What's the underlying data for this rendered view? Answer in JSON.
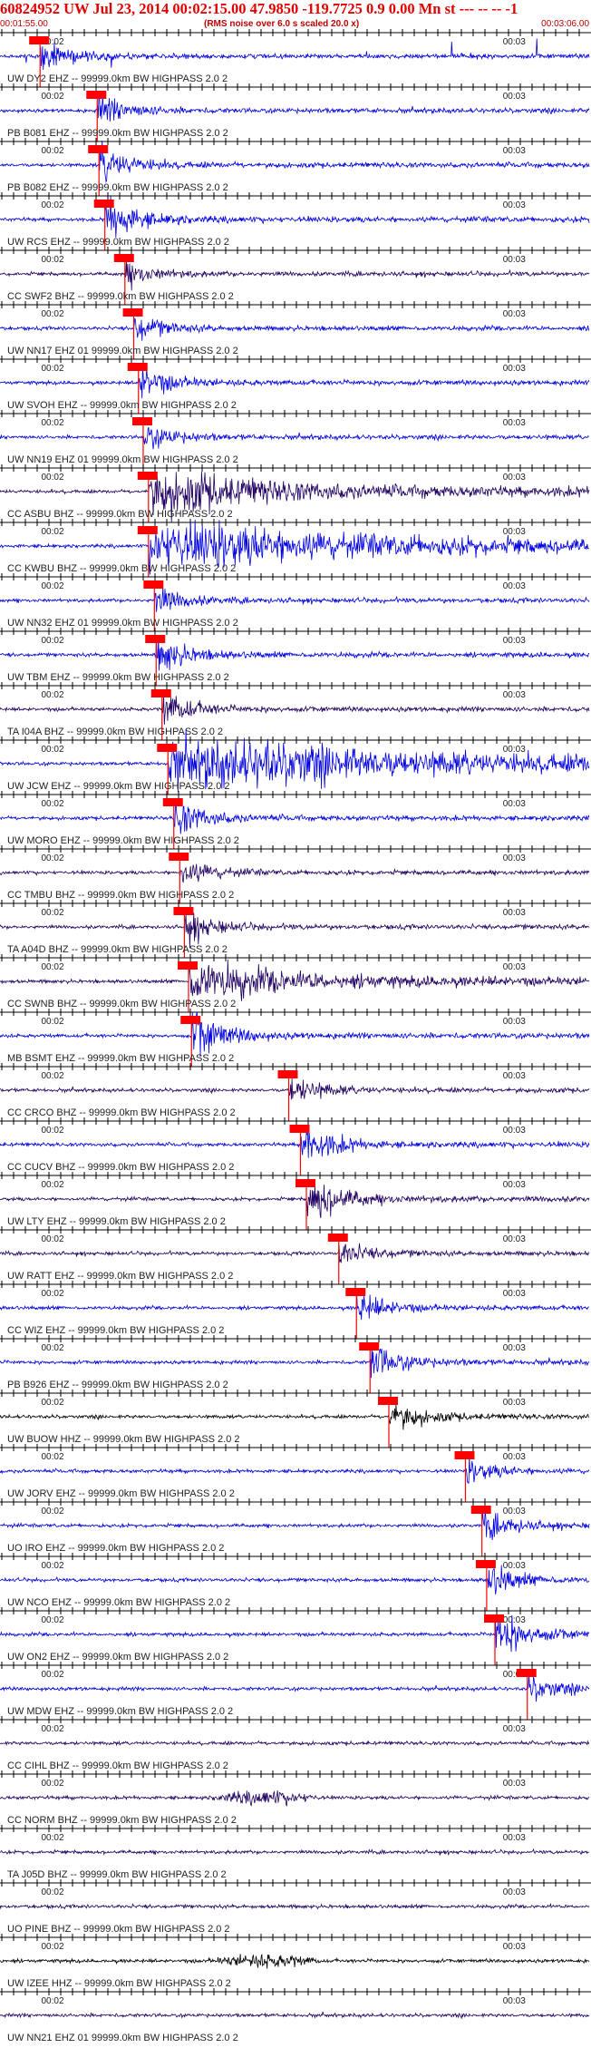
{
  "header": {
    "title": "60824952 UW Jul 23, 2014 00:02:15.00    47.9850 -119.7725  0.9 0.00 Mn st --- -- --  -1",
    "start_time": "00:01:55.00",
    "rms_note": "(RMS noise over 6.0 s scaled 20.0 x)",
    "end_time": "00:03:06.00"
  },
  "chart_data": {
    "type": "seismogram-record-section",
    "time_range": [
      "00:01:55.00",
      "00:03:06.00"
    ],
    "tick_marks": [
      "00:02",
      "00:03"
    ],
    "pick_color": "#ff0000",
    "traces": [
      {
        "label": "UW DY2 EHZ -- 99999.0km BW  HIGHPASS  2.0  2",
        "color": "#0000e0",
        "pick": 0.068,
        "amp": 0.35,
        "style": "spikes"
      },
      {
        "label": "PB B081 EHZ -- 99999.0km BW  HIGHPASS  2.0  2",
        "color": "#0000e0",
        "pick": 0.165,
        "amp": 0.45,
        "style": "event"
      },
      {
        "label": "PB B082 EHZ -- 99999.0km BW  HIGHPASS  2.0  2",
        "color": "#0000e0",
        "pick": 0.168,
        "amp": 0.6,
        "style": "event"
      },
      {
        "label": "UW RCS EHZ -- 99999.0km BW  HIGHPASS  2.0  2",
        "color": "#0000e0",
        "pick": 0.178,
        "amp": 0.9,
        "style": "event"
      },
      {
        "label": "CC SWF2 BHZ -- 99999.0km BW  HIGHPASS  2.0  2",
        "color": "#200060",
        "pick": 0.212,
        "amp": 0.3,
        "style": "noise"
      },
      {
        "label": "UW NN17 EHZ 01 99999.0km BW  HIGHPASS  2.0  2",
        "color": "#0000e0",
        "pick": 0.227,
        "amp": 0.3,
        "style": "noise"
      },
      {
        "label": "UW SVOH EHZ -- 99999.0km BW  HIGHPASS  2.0  2",
        "color": "#0000e0",
        "pick": 0.235,
        "amp": 0.55,
        "style": "event"
      },
      {
        "label": "UW NN19 EHZ 01 99999.0km BW  HIGHPASS  2.0  2",
        "color": "#0000e0",
        "pick": 0.243,
        "amp": 0.35,
        "style": "noise"
      },
      {
        "label": "CC ASBU BHZ -- 99999.0km BW  HIGHPASS  2.0  2",
        "color": "#200060",
        "pick": 0.252,
        "amp": 1.0,
        "style": "burst"
      },
      {
        "label": "CC KWBU BHZ -- 99999.0km BW  HIGHPASS  2.0  2",
        "color": "#0000e0",
        "pick": 0.252,
        "amp": 1.0,
        "style": "long"
      },
      {
        "label": "UW NN32 EHZ 01 99999.0km BW  HIGHPASS  2.0  2",
        "color": "#0000e0",
        "pick": 0.262,
        "amp": 0.4,
        "style": "event"
      },
      {
        "label": "UW TBM EHZ -- 99999.0km BW  HIGHPASS  2.0  2",
        "color": "#0000e0",
        "pick": 0.265,
        "amp": 0.55,
        "style": "event"
      },
      {
        "label": "TA I04A BHZ -- 99999.0km BW  HIGHPASS  2.0  2",
        "color": "#200060",
        "pick": 0.275,
        "amp": 0.5,
        "style": "event"
      },
      {
        "label": "UW JCW EHZ -- 99999.0km BW  HIGHPASS  2.0  2",
        "color": "#0000e0",
        "pick": 0.285,
        "amp": 1.3,
        "style": "big"
      },
      {
        "label": "UW MORO EHZ -- 99999.0km BW  HIGHPASS  2.0  2",
        "color": "#0000e0",
        "pick": 0.295,
        "amp": 0.6,
        "style": "event"
      },
      {
        "label": "CC TMBU BHZ -- 99999.0km BW  HIGHPASS  2.0  2",
        "color": "#200060",
        "pick": 0.305,
        "amp": 0.4,
        "style": "event"
      },
      {
        "label": "TA A04D BHZ -- 99999.0km BW  HIGHPASS  2.0  2",
        "color": "#200060",
        "pick": 0.313,
        "amp": 0.4,
        "style": "noise"
      },
      {
        "label": "CC SWNB BHZ -- 99999.0km BW  HIGHPASS  2.0  2",
        "color": "#200060",
        "pick": 0.32,
        "amp": 0.7,
        "style": "burst"
      },
      {
        "label": "MB BSMT EHZ -- 99999.0km BW  HIGHPASS  2.0  2",
        "color": "#0000e0",
        "pick": 0.325,
        "amp": 0.9,
        "style": "event"
      },
      {
        "label": "CC CRCO BHZ -- 99999.0km BW  HIGHPASS  2.0  2",
        "color": "#200060",
        "pick": 0.49,
        "amp": 0.45,
        "style": "event"
      },
      {
        "label": "CC CUCV BHZ -- 99999.0km BW  HIGHPASS  2.0  2",
        "color": "#0000e0",
        "pick": 0.51,
        "amp": 0.8,
        "style": "event"
      },
      {
        "label": "UW LTY EHZ -- 99999.0km BW  HIGHPASS  2.0  2",
        "color": "#200060",
        "pick": 0.52,
        "amp": 1.1,
        "style": "event"
      },
      {
        "label": "UW RATT EHZ -- 99999.0km BW  HIGHPASS  2.0  2",
        "color": "#200060",
        "pick": 0.575,
        "amp": 0.3,
        "style": "noise"
      },
      {
        "label": "CC WIZ EHZ -- 99999.0km BW  HIGHPASS  2.0  2",
        "color": "#0000e0",
        "pick": 0.605,
        "amp": 0.4,
        "style": "noise"
      },
      {
        "label": "PB B926 EHZ -- 99999.0km BW  HIGHPASS  2.0  2",
        "color": "#0000e0",
        "pick": 0.628,
        "amp": 0.6,
        "style": "event"
      },
      {
        "label": "UW BUOW HHZ -- 99999.0km BW  HIGHPASS  2.0  2",
        "color": "#000000",
        "pick": 0.66,
        "amp": 0.5,
        "style": "event"
      },
      {
        "label": "UW JORV EHZ -- 99999.0km BW  HIGHPASS  2.0  2",
        "color": "#0000e0",
        "pick": 0.79,
        "amp": 0.3,
        "style": "event"
      },
      {
        "label": "UO IRO EHZ -- 99999.0km BW  HIGHPASS  2.0  2",
        "color": "#0000e0",
        "pick": 0.818,
        "amp": 0.4,
        "style": "event"
      },
      {
        "label": "UW NCO EHZ -- 99999.0km BW  HIGHPASS  2.0  2",
        "color": "#0000e0",
        "pick": 0.826,
        "amp": 0.45,
        "style": "event"
      },
      {
        "label": "UW ON2 EHZ -- 99999.0km BW  HIGHPASS  2.0  2",
        "color": "#0000e0",
        "pick": 0.84,
        "amp": 0.8,
        "style": "event"
      },
      {
        "label": "UW MDW EHZ -- 99999.0km BW  HIGHPASS  2.0  2",
        "color": "#0000e0",
        "pick": 0.895,
        "amp": 0.35,
        "style": "event"
      },
      {
        "label": "CC CIHL BHZ -- 99999.0km BW  HIGHPASS  2.0  2",
        "color": "#200060",
        "pick": null,
        "amp": 0.2,
        "style": "noise"
      },
      {
        "label": "CC NORM BHZ -- 99999.0km BW  HIGHPASS  2.0  2",
        "color": "#200060",
        "pick": null,
        "amp": 0.45,
        "style": "burst"
      },
      {
        "label": "TA J05D BHZ -- 99999.0km BW  HIGHPASS  2.0  2",
        "color": "#200060",
        "pick": null,
        "amp": 0.12,
        "style": "noise"
      },
      {
        "label": "UO PINE BHZ -- 99999.0km BW  HIGHPASS  2.0  2",
        "color": "#200060",
        "pick": null,
        "amp": 0.15,
        "style": "noise"
      },
      {
        "label": "UW IZEE HHZ -- 99999.0km BW  HIGHPASS  2.0  2",
        "color": "#000000",
        "pick": null,
        "amp": 0.35,
        "style": "burst"
      },
      {
        "label": "UW NN21 EHZ 01 99999.0km BW  HIGHPASS  2.0  2",
        "color": "#200060",
        "pick": null,
        "amp": 0.2,
        "style": "noise"
      }
    ]
  }
}
